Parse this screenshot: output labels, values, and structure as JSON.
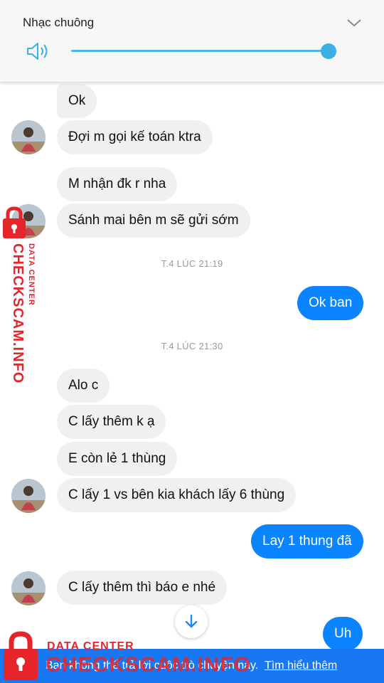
{
  "volume_panel": {
    "title": "Nhạc chuông",
    "level": 1.0
  },
  "messages": [
    {
      "text": "Ok",
      "direction": "in"
    },
    {
      "text": "Đợi m gọi kế toán ktra",
      "direction": "in"
    },
    {
      "text": "M nhận đk r nha",
      "direction": "in"
    },
    {
      "text": "Sánh mai bên m sẽ gửi sớm",
      "direction": "in"
    },
    {
      "text": "Ok ban",
      "direction": "out"
    },
    {
      "text": "Alo c",
      "direction": "in"
    },
    {
      "text": "C lấy thêm k ạ",
      "direction": "in"
    },
    {
      "text": "E còn lẻ 1 thùng",
      "direction": "in"
    },
    {
      "text": "C lấy 1 vs bên kia khách lấy 6 thùng",
      "direction": "in"
    },
    {
      "text": "Lay 1 thung đã",
      "direction": "out"
    },
    {
      "text": "C lấy thêm thì báo e nhé",
      "direction": "in"
    },
    {
      "text": "Uh",
      "direction": "out"
    }
  ],
  "timestamps": [
    "T.4 LÚC 21:19",
    "T.4 LÚC 21:30"
  ],
  "footer": {
    "text": "Bạn không thể trả lời cuộc trò chuyện này.",
    "link": "Tìm hiểu thêm"
  },
  "watermark": {
    "main": "CHECKSCAM.INFO",
    "sub": "DATA CENTER"
  },
  "colors": {
    "outgoing_bubble": "#0a84ff",
    "incoming_bubble": "#f1f0f0",
    "footer_bar": "#1877f2",
    "watermark": "#e6252a"
  },
  "icons": {
    "volume": "speaker-icon",
    "collapse": "chevron-down-icon",
    "scroll": "arrow-down-icon",
    "watermark": "padlock-icon"
  }
}
